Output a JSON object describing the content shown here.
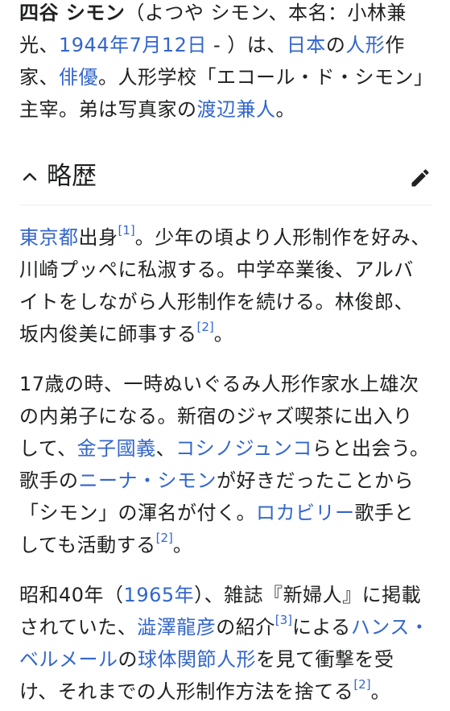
{
  "lead": {
    "subject": "四谷 シモン",
    "text_1": "（よつや シモン、本名：小林兼光、",
    "link_birthdate": "1944年7月12日",
    "text_2": " - ）は、",
    "link_japan": "日本",
    "text_3": "の",
    "link_doll": "人形",
    "text_4": "作家、",
    "link_actor": "俳優",
    "text_5": "。人形学校「エコール・ド・シモン」主宰。弟は写真家の",
    "link_brother": "渡辺兼人",
    "text_6": "。"
  },
  "section": {
    "title": "略歴",
    "collapse_icon": "chevron-up-icon",
    "edit_icon": "pencil-icon"
  },
  "p1": {
    "link_tokyo": "東京都",
    "text_1": "出身",
    "ref_1": "[1]",
    "text_2": "。少年の頃より人形制作を好み、川崎プッペに私淑する。中学卒業後、アルバイトをしながら人形制作を続ける。林俊郎、坂内俊美に師事する",
    "ref_2": "[2]",
    "text_3": "。"
  },
  "p2": {
    "text_1": "17歳の時、一時ぬいぐるみ人形作家水上雄次の内弟子になる。新宿のジャズ喫茶に出入りして、",
    "link_kaneko": "金子國義",
    "text_2": "、",
    "link_koshino": "コシノジュンコ",
    "text_3": "らと出会う。歌手の",
    "link_nina": "ニーナ・シモン",
    "text_4": "が好きだったことから「シモン」の渾名が付く。",
    "link_rockabilly": "ロカビリー",
    "text_5": "歌手としても活動する",
    "ref_1": "[2]",
    "text_6": "。"
  },
  "p3": {
    "text_1": "昭和40年（",
    "link_1965": "1965年",
    "text_2": "）、雑誌『新婦人』に掲載されていた、",
    "link_shibusawa": "澁澤龍彦",
    "text_3": "の紹介",
    "ref_1": "[3]",
    "text_4": "による",
    "link_bellmer": "ハンス・ベルメール",
    "text_5": "の",
    "link_bjd": "球体関節人形",
    "text_6": "を見て衝撃を受け、それまでの人形制作方法を捨てる",
    "ref_2": "[2]",
    "text_7": "。"
  },
  "colors": {
    "link": "#3366cc",
    "text": "#202122",
    "divider": "#eaecf0",
    "icon": "#202122"
  }
}
